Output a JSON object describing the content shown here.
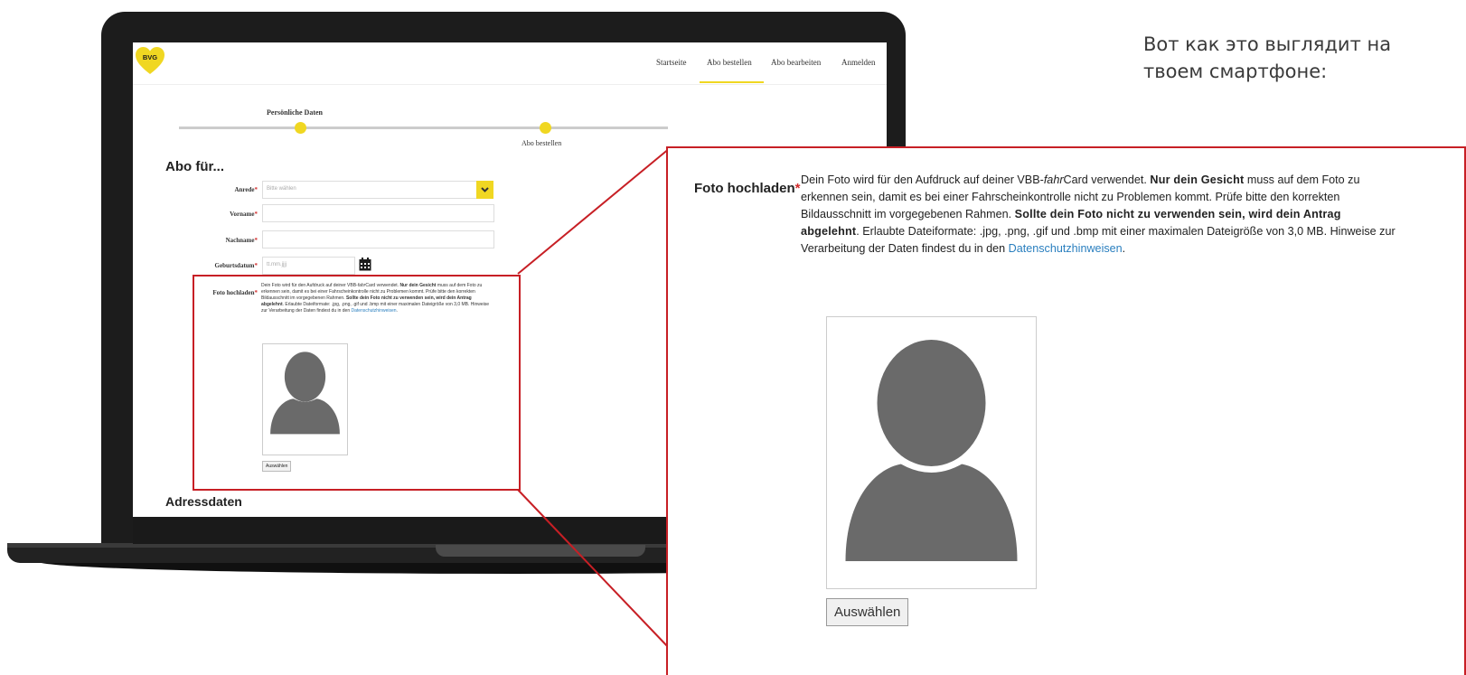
{
  "caption": {
    "line1": "Вот как это выглядит на",
    "line2": "твоем смартфоне:"
  },
  "laptop": {
    "logo_text": "BVG",
    "nav": [
      "Startseite",
      "Abo bestellen",
      "Abo bearbeiten",
      "Anmelden"
    ],
    "active_nav_index": 1,
    "steps": [
      {
        "label": "Persönliche Daten"
      },
      {
        "label": "Abo bestellen"
      }
    ],
    "section_title": "Abo für...",
    "fields": {
      "anrede": {
        "label": "Anrede",
        "placeholder": "Bitte wählen"
      },
      "vorname": {
        "label": "Vorname"
      },
      "nachname": {
        "label": "Nachname"
      },
      "geburtsdatum": {
        "label": "Geburtsdatum",
        "placeholder": "tt.mm.jjjj"
      }
    },
    "photo_label": "Foto hochladen",
    "select_button": "Auswählen",
    "next_section": "Adressdaten"
  },
  "photo_upload": {
    "label": "Foto hochladen",
    "required_mark": "*",
    "desc_1": "Dein Foto wird für den Aufdruck auf deiner VBB-",
    "desc_fahr": "fahr",
    "desc_2": "Card verwendet. ",
    "desc_bold_1": "Nur dein Gesicht",
    "desc_3": " muss auf dem Foto zu erkennen sein, damit es bei einer Fahrscheinkontrolle nicht zu Problemen kommt. Prüfe bitte den korrekten Bildausschnitt im vorgegebenen Rahmen. ",
    "desc_bold_2": "Sollte dein Foto nicht zu verwenden sein, wird dein Antrag abgelehnt",
    "desc_4": ". Erlaubte Dateiformate: .jpg, .png, .gif und .bmp mit einer maximalen Dateigröße von 3,0 MB. Hinweise zur Verarbeitung der Daten findest du in den ",
    "desc_link": "Datenschutzhinweisen",
    "desc_5": ".",
    "button": "Auswählen"
  },
  "colors": {
    "brand_yellow": "#f0d722",
    "highlight_red": "#c71f25",
    "link_blue": "#2a7fbf"
  }
}
